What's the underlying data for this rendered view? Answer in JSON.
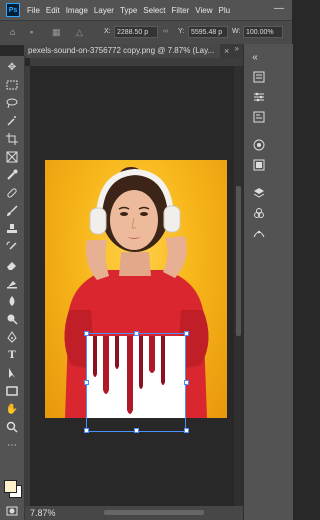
{
  "app": {
    "logo": "Ps"
  },
  "menu": [
    "File",
    "Edit",
    "Image",
    "Layer",
    "Type",
    "Select",
    "Filter",
    "View",
    "Plu"
  ],
  "options": {
    "x_label": "X:",
    "x_value": "2288.50 p",
    "y_label": "Y:",
    "y_value": "5595.48 p",
    "w_label": "W:",
    "w_value": "100.00%"
  },
  "tab": {
    "title": "pexels-sound-on-3756772 copy.png @ 7.87% (Lay..."
  },
  "status": {
    "zoom": "7.87%"
  },
  "colors": {
    "foreground": "#fdf1cc",
    "background": "#ffffff",
    "accent": "#4d8fff"
  },
  "icons": [
    "home-icon",
    "move-icon",
    "marquee-icon",
    "lasso-icon",
    "magic-wand-icon",
    "crop-icon",
    "eyedropper-icon",
    "healing-icon",
    "brush-icon",
    "stamp-icon",
    "history-brush-icon",
    "eraser-icon",
    "gradient-icon",
    "blur-icon",
    "dodge-icon",
    "pen-icon",
    "type-icon",
    "path-select-icon",
    "shape-icon",
    "hand-icon",
    "zoom-icon",
    "more-tools-icon"
  ]
}
